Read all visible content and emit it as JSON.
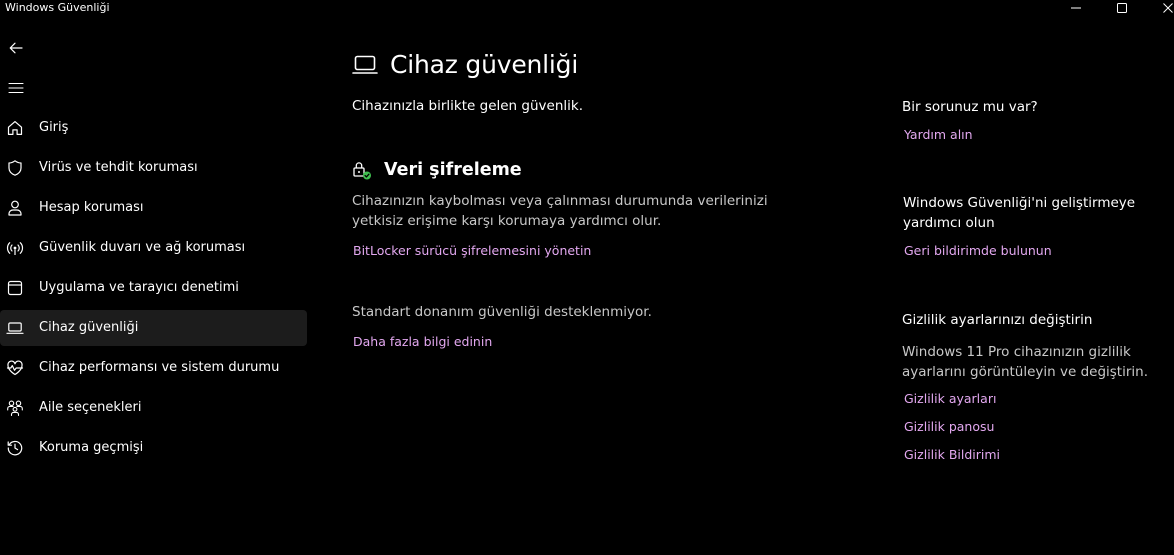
{
  "app": {
    "title": "Windows Güvenliği"
  },
  "sidebar": {
    "items": [
      {
        "label": "Giriş",
        "icon": "home-icon"
      },
      {
        "label": "Virüs ve tehdit koruması",
        "icon": "shield-icon"
      },
      {
        "label": "Hesap koruması",
        "icon": "person-icon"
      },
      {
        "label": "Güvenlik duvarı ve ağ koruması",
        "icon": "antenna-icon"
      },
      {
        "label": "Uygulama ve tarayıcı denetimi",
        "icon": "browser-window-icon"
      },
      {
        "label": "Cihaz güvenliği",
        "icon": "laptop-icon"
      },
      {
        "label": "Cihaz performansı ve sistem durumu",
        "icon": "heart-pulse-icon"
      },
      {
        "label": "Aile seçenekleri",
        "icon": "family-icon"
      },
      {
        "label": "Koruma geçmişi",
        "icon": "history-icon"
      }
    ],
    "selected_index": 5
  },
  "main": {
    "title": "Cihaz güvenliği",
    "subtitle": "Cihazınızla birlikte gelen güvenlik.",
    "encryption": {
      "title": "Veri şifreleme",
      "description": "Cihazınızın kaybolması veya çalınması durumunda verilerinizi yetkisiz erişime karşı korumaya yardımcı olur.",
      "link": "BitLocker sürücü şifrelemesini yönetin"
    },
    "hardware": {
      "text": "Standart donanım güvenliği desteklenmiyor.",
      "link": "Daha fazla bilgi edinin"
    }
  },
  "right": {
    "help": {
      "heading": "Bir sorunuz mu var?",
      "link": "Yardım alın"
    },
    "feedback": {
      "heading": "Windows Güvenliği'ni geliştirmeye yardımcı olun",
      "link": "Geri bildirimde bulunun"
    },
    "privacy": {
      "heading": "Gizlilik ayarlarınızı değiştirin",
      "text": "Windows 11 Pro cihazınızın gizlilik ayarlarını görüntüleyin ve değiştirin.",
      "links": [
        "Gizlilik ayarları",
        "Gizlilik panosu",
        "Gizlilik Bildirimi"
      ]
    }
  },
  "colors": {
    "background": "#000000",
    "link": "#e3a8f0",
    "selected": "#1c1c1c",
    "secondary_text": "#c8c8c8",
    "status_ok": "#3fbf4f"
  }
}
